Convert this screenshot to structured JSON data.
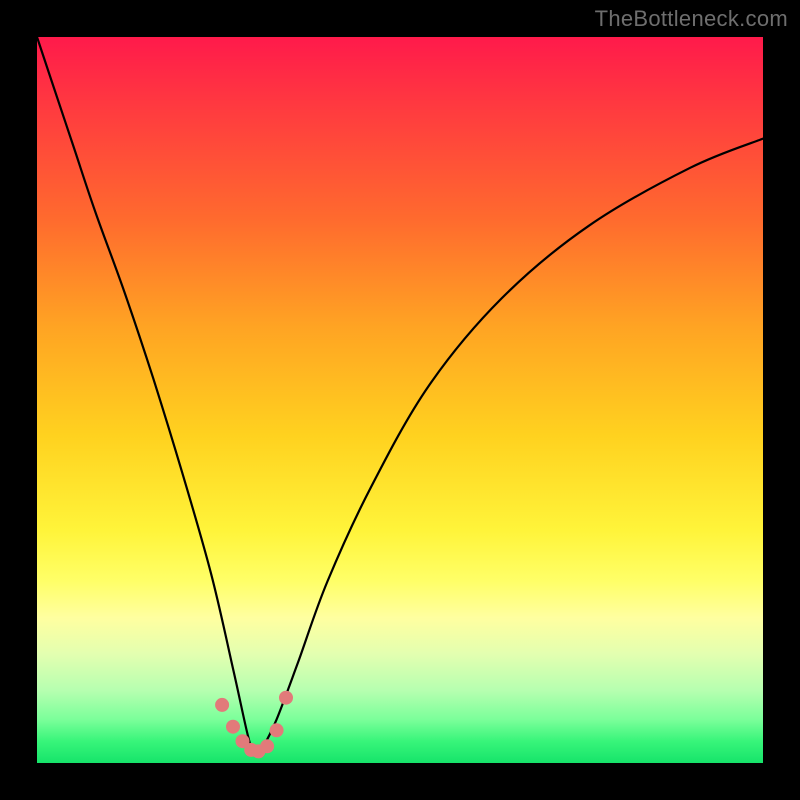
{
  "attribution": "TheBottleneck.com",
  "colors": {
    "page_bg": "#000000",
    "gradient_top": "#ff1a4b",
    "gradient_bottom": "#16e46a",
    "curve": "#000000",
    "markers": "#e27a7a",
    "attr_text": "#6e6e6e"
  },
  "chart_data": {
    "type": "line",
    "title": "",
    "xlabel": "",
    "ylabel": "",
    "xlim": [
      0,
      100
    ],
    "ylim": [
      0,
      100
    ],
    "grid": false,
    "legend": false,
    "note": "Background vertical gradient encodes a heat scale (red=top, green=bottom). Curve is a V-shaped dip with minimum near x≈30, y≈0. Values estimated from pixels.",
    "series": [
      {
        "name": "curve",
        "x": [
          0,
          2,
          5,
          8,
          12,
          16,
          20,
          24,
          27,
          29,
          30,
          31,
          33,
          36,
          40,
          46,
          54,
          64,
          76,
          90,
          100
        ],
        "y": [
          100,
          94,
          85,
          76,
          65,
          53,
          40,
          26,
          13,
          4,
          1,
          2,
          6,
          14,
          25,
          38,
          52,
          64,
          74,
          82,
          86
        ]
      }
    ],
    "markers": {
      "name": "highlight-dots",
      "x": [
        25.5,
        27.0,
        28.3,
        29.5,
        30.5,
        31.7,
        33.0,
        34.3
      ],
      "y": [
        8.0,
        5.0,
        3.0,
        1.8,
        1.6,
        2.3,
        4.5,
        9.0
      ]
    }
  }
}
